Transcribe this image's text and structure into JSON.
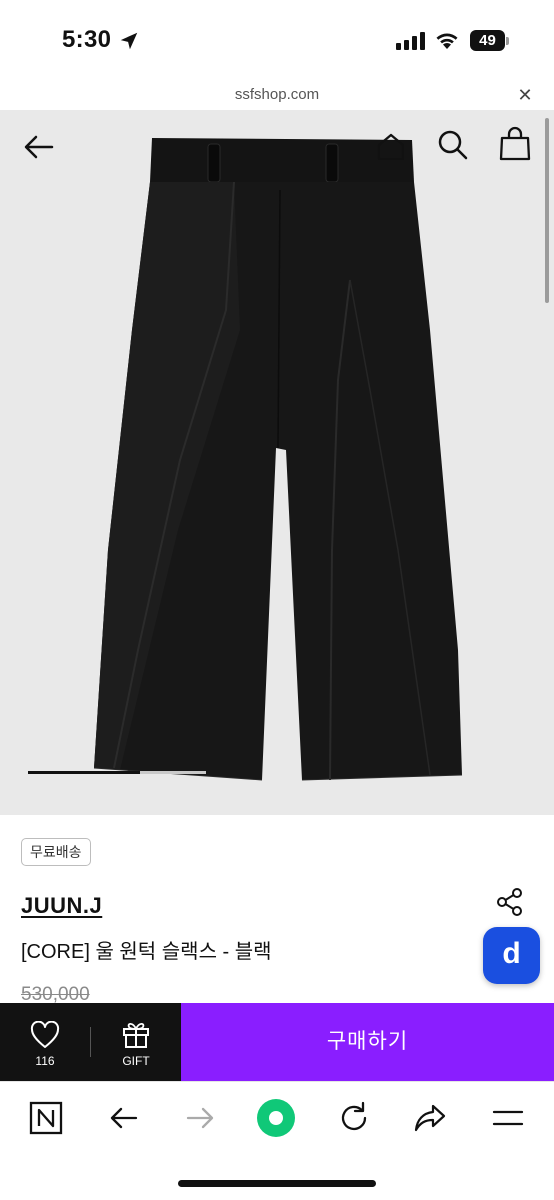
{
  "status_bar": {
    "time": "5:30",
    "battery": "49"
  },
  "browser": {
    "url": "ssfshop.com"
  },
  "gallery": {
    "image_alt": "JUUN.J black wool one-tuck wide slacks"
  },
  "product": {
    "badge": "무료배송",
    "brand": "JUUN.J",
    "name": "[CORE] 울 원턱 슬랙스 - 블랙",
    "original_price": "530,000",
    "floating_button": "d"
  },
  "purchase_bar": {
    "like_count": "116",
    "gift_label": "GIFT",
    "buy_label": "구매하기"
  },
  "colors": {
    "accent": "#8a1eff",
    "dark": "#121212",
    "d_button": "#1a4fe0",
    "nav_green": "#10c878"
  }
}
